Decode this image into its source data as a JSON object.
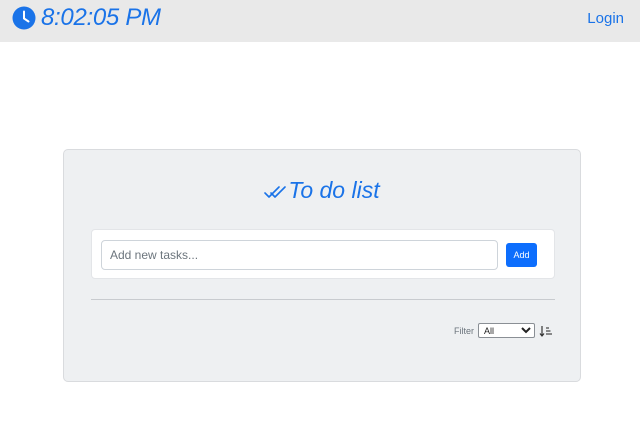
{
  "header": {
    "clock_icon": "clock-icon",
    "time": "8:02:05 PM",
    "login_label": "Login"
  },
  "card": {
    "title_icon": "double-check-icon",
    "title": "To do list",
    "input": {
      "placeholder": "Add new tasks...",
      "value": ""
    },
    "add_label": "Add",
    "filter": {
      "label": "Filter",
      "selected": "All"
    },
    "sort_icon": "sort-ascending-icon"
  },
  "colors": {
    "accent": "#1a73e8",
    "button": "#0d6efd",
    "topbar": "#e9e9e9",
    "card": "#eef0f2"
  }
}
